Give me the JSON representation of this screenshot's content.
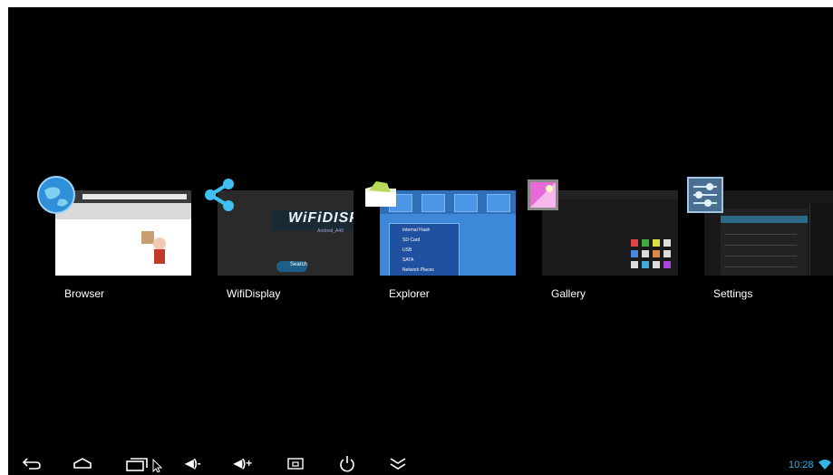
{
  "recent_apps": [
    {
      "label": "Browser",
      "icon": "globe-icon"
    },
    {
      "label": "WifiDisplay",
      "icon": "share-icon"
    },
    {
      "label": "Explorer",
      "icon": "folder-icon"
    },
    {
      "label": "Gallery",
      "icon": "picture-icon"
    },
    {
      "label": "Settings",
      "icon": "sliders-icon"
    }
  ],
  "thumbnails": {
    "wifidisplay_title": "WiFiDISP",
    "wifidisplay_sub": "Android_A49",
    "wifidisplay_search": "Search",
    "explorer_items": [
      "Internal Flash",
      "SD Card",
      "USB",
      "SATA",
      "Network Places"
    ]
  },
  "navbar": {
    "back": "back-icon",
    "home": "home-icon",
    "recents": "recents-icon",
    "vol_down": "◀)-",
    "vol_up": "◀)+",
    "screenshot": "screenshot-icon",
    "power": "power-icon",
    "hide": "chevron-down-icon"
  },
  "status": {
    "time": "10:28"
  },
  "colors": {
    "accent": "#33b5e5",
    "background": "#000000"
  }
}
